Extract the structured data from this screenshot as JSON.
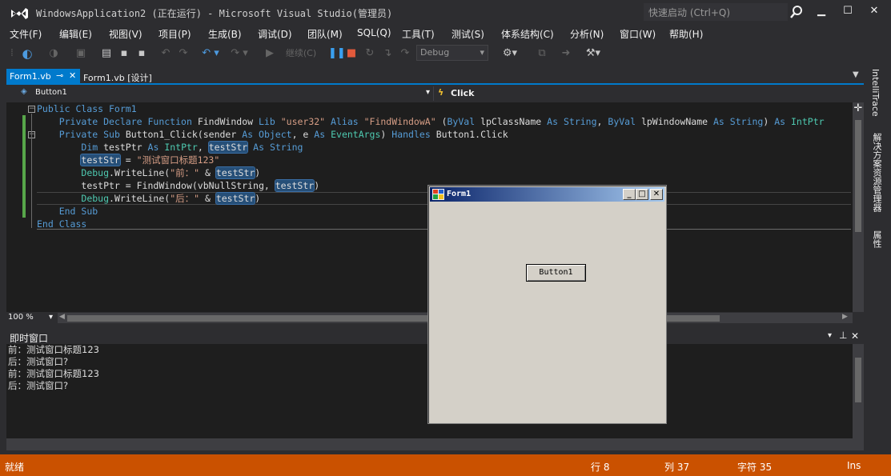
{
  "window": {
    "title": "WindowsApplication2 (正在运行) - Microsoft Visual Studio(管理员)",
    "quick_launch_placeholder": "快速启动 (Ctrl+Q)"
  },
  "menu": [
    "文件(F)",
    "编辑(E)",
    "视图(V)",
    "项目(P)",
    "生成(B)",
    "调试(D)",
    "团队(M)",
    "SQL(Q)",
    "工具(T)",
    "测试(S)",
    "体系结构(C)",
    "分析(N)",
    "窗口(W)",
    "帮助(H)"
  ],
  "toolbar": {
    "continue_label": "继续(C)",
    "configuration": "Debug"
  },
  "tabs": {
    "active": "Form1.vb",
    "design": "Form1.vb [设计]"
  },
  "navbar": {
    "object": "Button1",
    "member": "Click"
  },
  "code": {
    "line1": "Public Class Form1",
    "line2_decl": "Private Declare Function",
    "line2_name": "FindWindow",
    "line2_lib": "Lib",
    "line2_libname": "\"user32\"",
    "line2_alias": "Alias",
    "line2_aliasname": "\"FindWindowA\"",
    "line2_params_open": "(",
    "line2_byval1": "ByVal",
    "line2_p1": "lpClassName",
    "line2_as1": "As",
    "line2_t1": "String",
    "line2_comma": ",",
    "line2_byval2": "ByVal",
    "line2_p2": "lpWindowName",
    "line2_as2": "As",
    "line2_t2": "String",
    "line2_close": ")",
    "line2_as3": "As",
    "line2_t3": "IntPtr",
    "line3_kw": "Private Sub",
    "line3_name": "Button1_Click(sender",
    "line3_as1": "As",
    "line3_t1": "Object",
    "line3_mid": ", e",
    "line3_as2": "As",
    "line3_t2": "EventArgs",
    "line3_close": ")",
    "line3_handles": "Handles",
    "line3_evt": "Button1.Click",
    "line4_dim": "Dim",
    "line4_var": "testPtr",
    "line4_as1": "As",
    "line4_t1": "IntPtr",
    "line4_comma": ",",
    "line4_var2": "testStr",
    "line4_as2": "As",
    "line4_t2": "String",
    "line5_var": "testStr",
    "line5_eq": " = ",
    "line5_str": "\"测试窗口标题123\"",
    "line6_obj": "Debug",
    "line6_call": ".WriteLine(",
    "line6_str": "\"前：\"",
    "line6_amp": " & ",
    "line6_var": "testStr",
    "line6_close": ")",
    "line7_pre": "testPtr = FindWindow(vbNullString, ",
    "line7_var": "testStr",
    "line7_close": ")",
    "line8_obj": "Debug",
    "line8_call": ".WriteLine(",
    "line8_str": "\"后：\"",
    "line8_amp": " & ",
    "line8_var": "testStr",
    "line8_close": ")",
    "line9": "End Sub",
    "line10": "End Class"
  },
  "editor": {
    "zoom": "100 %"
  },
  "immediate": {
    "title": "即时窗口",
    "output": "前：测试窗口标题123\n后：测试窗口?\n前：测试窗口标题123\n后：测试窗口?"
  },
  "side_panel": {
    "intellitrace": "IntelliTrace",
    "solution_explorer": "解决方案资源管理器",
    "properties": "属性"
  },
  "status": {
    "state": "就绪",
    "line": "行 8",
    "col": "列 37",
    "char": "字符 35",
    "mode": "Ins"
  },
  "form1": {
    "caption": "Form1",
    "button_label": "Button1"
  },
  "colors": {
    "accent": "#007acc",
    "status_debug": "#ca5100",
    "editor_bg": "#1e1e1e",
    "chrome_bg": "#2d2d30"
  }
}
